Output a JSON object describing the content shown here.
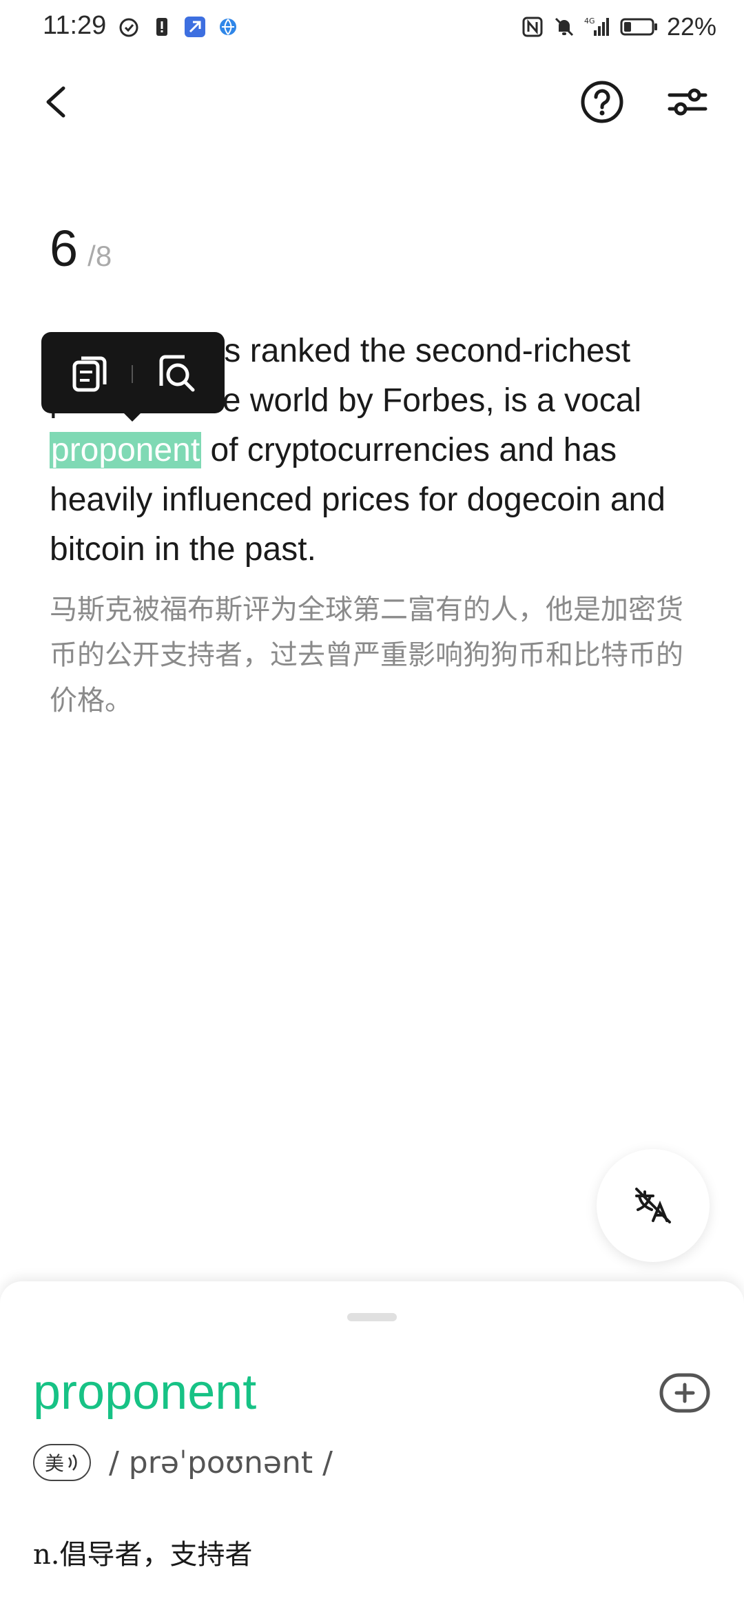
{
  "status_bar": {
    "time": "11:29",
    "battery": "22%",
    "left_icons": [
      "alarm-icon",
      "notification-icon",
      "app-icon",
      "browser-icon"
    ],
    "right_icons": [
      "nfc-icon",
      "mute-icon",
      "signal-4g-icon",
      "battery-icon"
    ]
  },
  "header": {
    "icons": [
      "back-arrow-icon",
      "help-icon",
      "settings-sliders-icon"
    ]
  },
  "progress": {
    "current": "6",
    "total": "/8"
  },
  "sentence": {
    "before": "Musk, who is ranked the second-richest person in the world by Forbes, is a vocal",
    "highlight": "proponent",
    "after": "of cryptocurrencies and has heavily influenced prices for dogecoin and bitcoin in the past.",
    "visible_fragments": [
      " is ranked the second-richest",
      "he world by Forbes, is a vocal"
    ]
  },
  "translation": "马斯克被福布斯评为全球第二富有的人，他是加密货币的公开支持者，过去曾严重影响狗狗币和比特币的价格。",
  "popup": {
    "icons": [
      "copy-icon",
      "search-icon"
    ]
  },
  "fab": {
    "icon": "hide-translation-icon"
  },
  "word_card": {
    "word": "proponent",
    "accent_label": "美",
    "phonetic": "/ prəˈpoʊnənt /",
    "definition": "n.倡导者，支持者",
    "word_color": "#17c285",
    "highlight_color": "#7fd9b4"
  }
}
